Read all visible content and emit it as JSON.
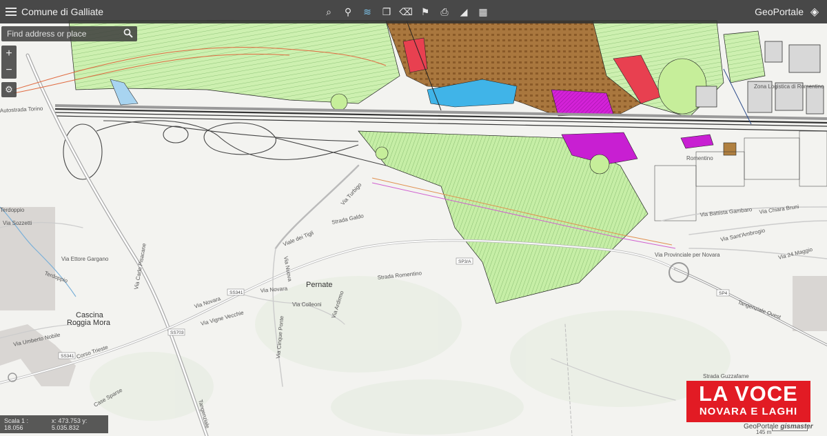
{
  "header": {
    "title": "Comune di Galliate",
    "brand": "GeoPortale",
    "tools": [
      {
        "icon": "search-map-icon",
        "glyph": "⌕"
      },
      {
        "icon": "binoculars-icon",
        "glyph": "⚲"
      },
      {
        "icon": "layers-stack-icon",
        "glyph": "≋"
      },
      {
        "icon": "copy-icon",
        "glyph": "❐"
      },
      {
        "icon": "eraser-icon",
        "glyph": "⌫"
      },
      {
        "icon": "pin-icon",
        "glyph": "⚑"
      },
      {
        "icon": "print-icon",
        "glyph": "⎙"
      },
      {
        "icon": "measure-icon",
        "glyph": "◢"
      },
      {
        "icon": "grid-icon",
        "glyph": "▦"
      }
    ]
  },
  "search": {
    "placeholder": "Find address or place"
  },
  "zoom": {
    "in": "+",
    "out": "−"
  },
  "status": {
    "scale": "Scala 1 : 18.056",
    "coords": "x: 473.753 y: 5.035.832"
  },
  "logo": {
    "line1": "LA VOCE",
    "line2": "NOVARA E LAGHI"
  },
  "attribution": {
    "left": "GeoPortale",
    "right": "gismaster"
  },
  "scale_length": "145 m",
  "map_labels": {
    "pernate": "Pernate",
    "cascina1": "Cascina",
    "cascina2": "Roggia Mora",
    "romentino": "Romentino",
    "autostrada": "Autostrada Torino",
    "viale_dei_tigli": "Viale dei Tigli",
    "via_turbigo": "Via Turbigo",
    "strada_galdo": "Strada Galdo",
    "via_novara": "Via Novara",
    "via_novara2": "Via Novara",
    "via_vigne_vecchie": "Via Vigne Vecchie",
    "via_colleoni": "Via Colleoni",
    "via_ardirmo": "Via Ardirmo",
    "strada_romentino": "Strada Romentino",
    "via_ettore_gargano": "Via Ettore Gargano",
    "via_carlo_pisacane": "Via Carlo Pisacane",
    "via_umberto": "Via Umberto Nobile",
    "corso_trieste": "Corso Trieste",
    "via_battista_gambaro": "Via Battista Gambaro",
    "via_sant_ambrogio": "Via Sant'Ambrogio",
    "via_chiara_bruni": "Via Chiara Bruni",
    "via_24_maggio": "Via 24 Maggio",
    "tangenziale_ovest": "Tangenziale Ovest",
    "via_provinciale": "Via Provinciale per Novara",
    "terdoppio": "Terdoppio",
    "terdoppio2": "Terdoppio",
    "via_sozzetti": "Via Sozzetti",
    "via_cinque_ponte": "Via Cinque Ponte",
    "via_nuova": "Via Nuova",
    "strada_guzzafame": "Strada Guzzafame",
    "case_sparse": "Case Sparse",
    "tangenziale": "Tangenziale",
    "zona_logistica": "Zona Logistica di Romentino",
    "ss341a": "SS341",
    "ss341b": "SS341",
    "ss703": "SS703",
    "sp3a": "SP3/A",
    "sp4": "SP4"
  },
  "colors": {
    "agri": "#c8efaa",
    "urban": "#a8743a",
    "industrial": "#d020d8",
    "commercial": "#40b4e8",
    "residential_red": "#e84050",
    "toolbar": "#303030"
  }
}
